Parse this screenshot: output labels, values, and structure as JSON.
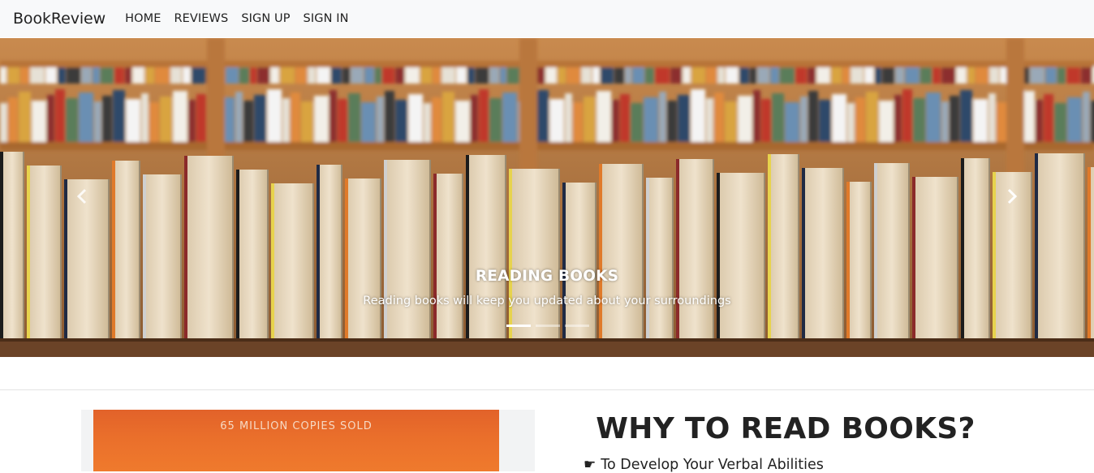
{
  "navbar": {
    "brand": "BookReview",
    "links": [
      {
        "label": "HOME"
      },
      {
        "label": "REVIEWS"
      },
      {
        "label": "SIGN UP"
      },
      {
        "label": "SIGN IN"
      }
    ]
  },
  "carousel": {
    "caption_title": "READING BOOKS",
    "caption_text": "Reading books will keep you updated about your surroundings",
    "indicators": 3,
    "active_index": 0,
    "prev_icon": "chevron-left-icon",
    "next_icon": "chevron-right-icon"
  },
  "featured_book": {
    "cover_text": "65 MILLION COPIES SOLD"
  },
  "why_section": {
    "title": "WHY TO READ BOOKS?",
    "items": [
      {
        "icon": "pointing-hand-icon",
        "text": "To Develop Your Verbal Abilities"
      }
    ]
  },
  "colors": {
    "navbar_bg": "#f8f9fa",
    "cover_orange": "#ea6f2b",
    "text_dark": "#222222"
  }
}
